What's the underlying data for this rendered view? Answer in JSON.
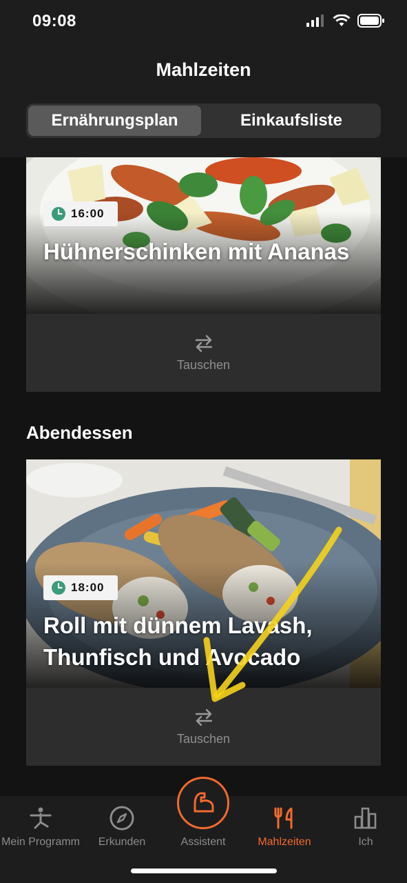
{
  "status_bar": {
    "time": "09:08"
  },
  "header": {
    "title": "Mahlzeiten",
    "tabs": [
      {
        "label": "Ernährungsplan",
        "active": true
      },
      {
        "label": "Einkaufsliste",
        "active": false
      }
    ]
  },
  "meals": [
    {
      "time": "16:00",
      "title": "Hühnerschinken mit Ananas",
      "swap_label": "Tauschen"
    },
    {
      "section": "Abendessen",
      "time": "18:00",
      "title": "Roll mit dünnem Lavash, Thunfisch und Avocado",
      "swap_label": "Tauschen"
    }
  ],
  "tabbar": {
    "items": [
      {
        "label": "Mein Programm",
        "icon": "person-yoga-icon"
      },
      {
        "label": "Erkunden",
        "icon": "compass-icon"
      },
      {
        "label": "Assistent",
        "icon": "flexed-arm-icon"
      },
      {
        "label": "Mahlzeiten",
        "icon": "fork-knife-icon",
        "active": true
      },
      {
        "label": "Ich",
        "icon": "bar-chart-icon"
      }
    ]
  },
  "colors": {
    "accent": "#f26a2e",
    "background": "#131313",
    "card": "#2d2d2d",
    "clock_green": "#3a9c7a"
  }
}
